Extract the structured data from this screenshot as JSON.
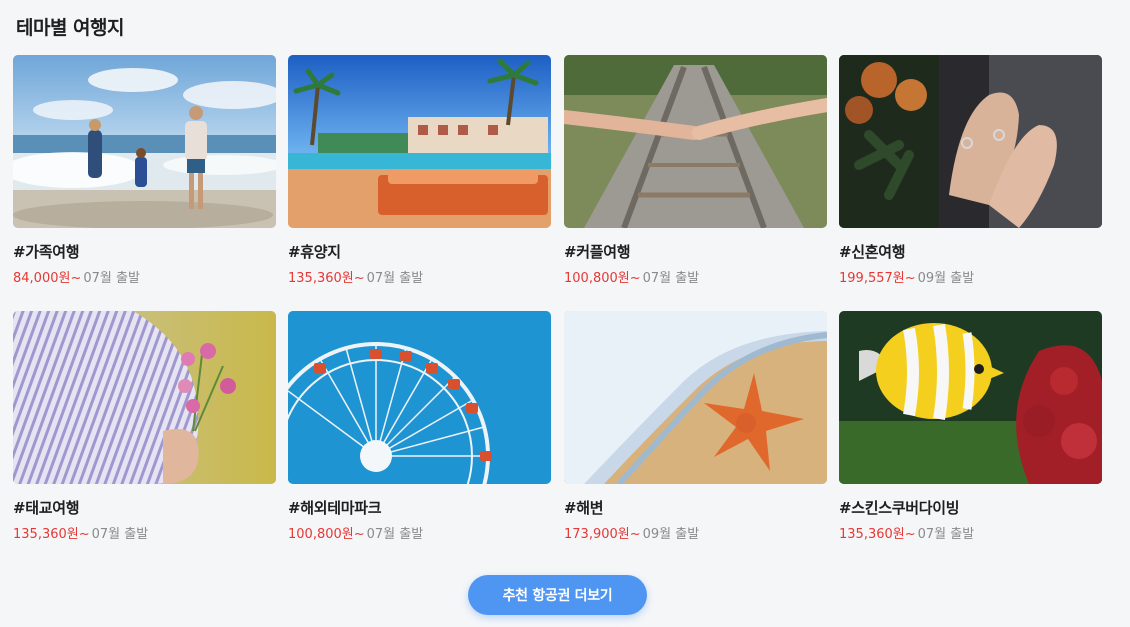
{
  "section": {
    "title": "테마별 여행지"
  },
  "cards": [
    {
      "tag": "#가족여행",
      "price": "84,000원~",
      "depart": "07월 출발",
      "image": "family-beach-photo"
    },
    {
      "tag": "#휴양지",
      "price": "135,360원~",
      "depart": "07월 출발",
      "image": "resort-pool-photo"
    },
    {
      "tag": "#커플여행",
      "price": "100,800원~",
      "depart": "07월 출발",
      "image": "couple-railway-photo"
    },
    {
      "tag": "#신혼여행",
      "price": "199,557원~",
      "depart": "09월 출발",
      "image": "wedding-rings-photo"
    },
    {
      "tag": "#태교여행",
      "price": "135,360원~",
      "depart": "07월 출발",
      "image": "pregnant-flowers-photo"
    },
    {
      "tag": "#해외테마파크",
      "price": "100,800원~",
      "depart": "07월 출발",
      "image": "ferris-wheel-photo"
    },
    {
      "tag": "#해변",
      "price": "173,900원~",
      "depart": "09월 출발",
      "image": "starfish-beach-photo"
    },
    {
      "tag": "#스킨스쿠버다이빙",
      "price": "135,360원~",
      "depart": "07월 출발",
      "image": "tropical-fish-photo"
    }
  ],
  "more_button": {
    "label": "추천 항공권 더보기"
  },
  "colors": {
    "price": "#e53935",
    "button": "#4f95f2",
    "background": "#f5f6f8"
  }
}
